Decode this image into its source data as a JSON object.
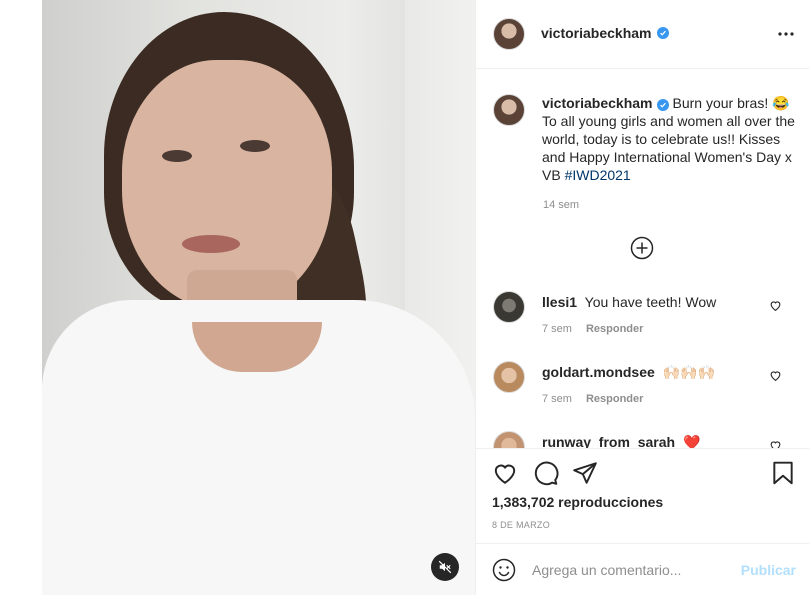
{
  "post": {
    "username": "victoriabeckham",
    "verified": true,
    "caption_text": "Burn your bras! 😂 To all young girls and women all over the world, today is to celebrate us!! Kisses and Happy International Women's Day x VB",
    "hashtag": "#IWD2021",
    "caption_time": "14 sem"
  },
  "comments": [
    {
      "username": "llesi1",
      "text": "You have teeth! Wow",
      "time": "7 sem",
      "reply_label": "Responder"
    },
    {
      "username": "goldart.mondsee",
      "text": "🙌🏻🙌🏻🙌🏻",
      "time": "7 sem",
      "reply_label": "Responder"
    },
    {
      "username": "runway_from_sarah",
      "text": "❤️",
      "time": "",
      "reply_label": ""
    }
  ],
  "actions": {
    "views": "1,383,702 reproducciones",
    "date": "8 DE MARZO"
  },
  "add_comment": {
    "placeholder": "Agrega un comentario...",
    "publish_label": "Publicar"
  },
  "colors": {
    "verified": "#3897f0",
    "hashtag": "#00376b",
    "publish_disabled": "#b2dffc",
    "heart_red": "#ed4956"
  },
  "icons": {
    "more": "more-horizontal-icon",
    "load_more": "plus-circle-icon",
    "like": "heart-icon",
    "comment": "comment-bubble-icon",
    "share": "paper-plane-icon",
    "save": "bookmark-icon",
    "emoji": "emoji-smile-icon",
    "mute": "speaker-muted-icon"
  }
}
